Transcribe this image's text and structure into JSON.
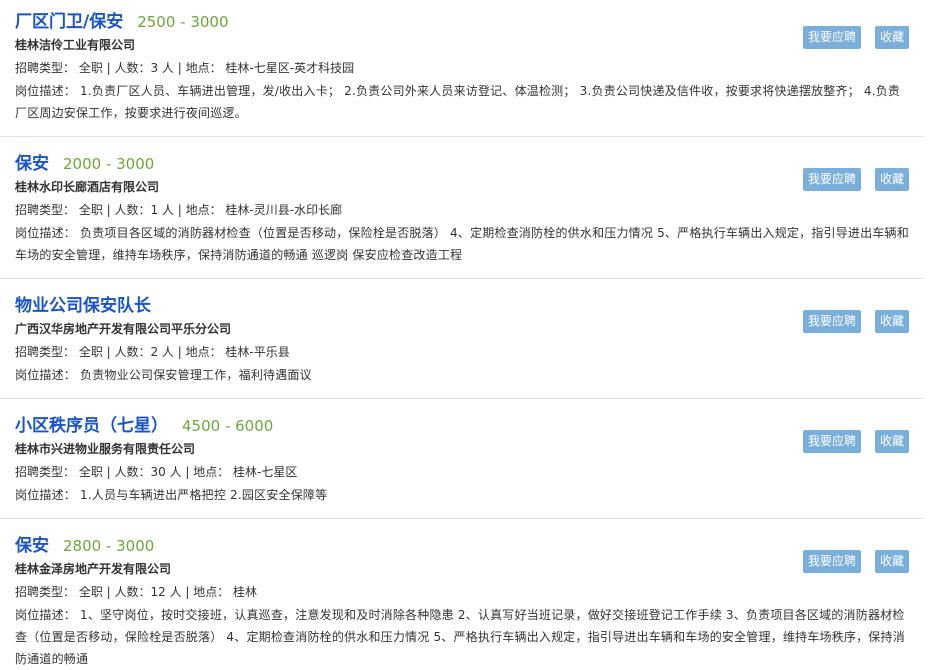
{
  "jobs": [
    {
      "title": "厂区门卫/保安",
      "salary": "2500 - 3000",
      "company": "桂林洁伶工业有限公司",
      "meta": "招聘类型：  全职 | 人数：3 人 | 地点：  桂林-七星区-英才科技园",
      "desc": "岗位描述：  1.负责厂区人员、车辆进出管理，发/收出入卡；  2.负责公司外来人员来访登记、体温检测；  3.负责公司快递及信件收，按要求将快递摆放整齐；  4.负责厂区周边安保工作，按要求进行夜间巡逻。",
      "apply_label": "我要应聘",
      "fav_label": "收藏"
    },
    {
      "title": "保安",
      "salary": "2000 - 3000",
      "company": "桂林水印长廊酒店有限公司",
      "meta": "招聘类型：  全职 | 人数：1 人 | 地点：  桂林-灵川县-水印长廊",
      "desc": "岗位描述：  负责项目各区域的消防器材检查（位置是否移动，保险栓是否脱落）  4、定期检查消防栓的供水和压力情况 5、严格执行车辆出入规定，指引导进出车辆和车场的安全管理，维持车场秩序，保持消防通道的畅通 巡逻岗 保安应检查改造工程",
      "apply_label": "我要应聘",
      "fav_label": "收藏"
    },
    {
      "title": "物业公司保安队长",
      "salary": "",
      "company": "广西汉华房地产开发有限公司平乐分公司",
      "meta": "招聘类型：  全职 | 人数：2 人 | 地点：  桂林-平乐县",
      "desc": "岗位描述：  负责物业公司保安管理工作，福利待遇面议",
      "apply_label": "我要应聘",
      "fav_label": "收藏"
    },
    {
      "title": "小区秩序员（七星）",
      "salary": "4500 - 6000",
      "company": "桂林市兴进物业服务有限责任公司",
      "meta": "招聘类型：  全职 | 人数：30 人 | 地点：  桂林-七星区",
      "desc": "岗位描述：  1.人员与车辆进出严格把控 2.园区安全保障等",
      "apply_label": "我要应聘",
      "fav_label": "收藏"
    },
    {
      "title": "保安",
      "salary": "2800 - 3000",
      "company": "桂林金泽房地产开发有限公司",
      "meta": "招聘类型：  全职 | 人数：12 人 | 地点：  桂林",
      "desc": "岗位描述：  1、坚守岗位，按时交接班，认真巡查，注意发现和及时消除各种隐患 2、认真写好当班记录，做好交接班登记工作手续 3、负责项目各区域的消防器材检查（位置是否移动，保险栓是否脱落）  4、定期检查消防栓的供水和压力情况 5、严格执行车辆出入规定，指引导进出车辆和车场的安全管理，维持车场秩序，保持消防通道的畅通",
      "apply_label": "我要应聘",
      "fav_label": "收藏"
    }
  ]
}
